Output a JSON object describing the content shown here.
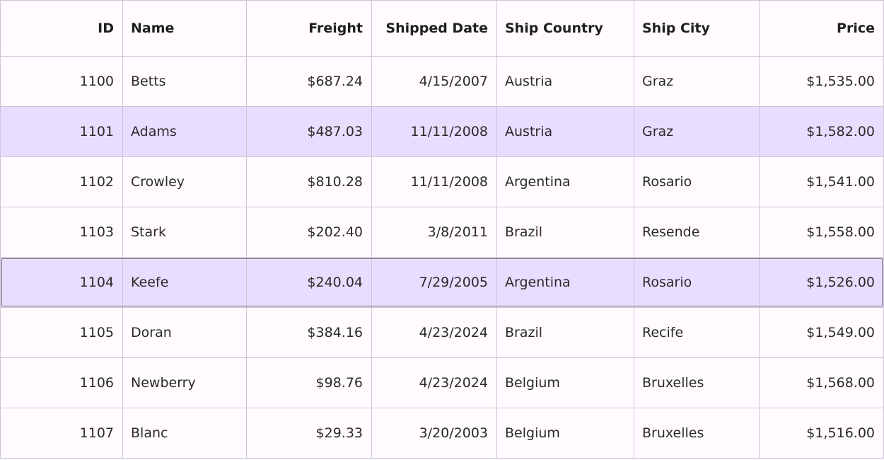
{
  "grid": {
    "columns": [
      {
        "key": "id",
        "label": "ID",
        "align": "right"
      },
      {
        "key": "name",
        "label": "Name",
        "align": "left"
      },
      {
        "key": "freight",
        "label": "Freight",
        "align": "right"
      },
      {
        "key": "shipped_date",
        "label": "Shipped Date",
        "align": "right"
      },
      {
        "key": "ship_country",
        "label": "Ship Country",
        "align": "left"
      },
      {
        "key": "ship_city",
        "label": "Ship City",
        "align": "left"
      },
      {
        "key": "price",
        "label": "Price",
        "align": "right"
      }
    ],
    "rows": [
      {
        "id": "1100",
        "name": "Betts",
        "freight": "$687.24",
        "shipped_date": "4/15/2007",
        "ship_country": "Austria",
        "ship_city": "Graz",
        "price": "$1,535.00",
        "selected": false
      },
      {
        "id": "1101",
        "name": "Adams",
        "freight": "$487.03",
        "shipped_date": "11/11/2008",
        "ship_country": "Austria",
        "ship_city": "Graz",
        "price": "$1,582.00",
        "selected": true
      },
      {
        "id": "1102",
        "name": "Crowley",
        "freight": "$810.28",
        "shipped_date": "11/11/2008",
        "ship_country": "Argentina",
        "ship_city": "Rosario",
        "price": "$1,541.00",
        "selected": false
      },
      {
        "id": "1103",
        "name": "Stark",
        "freight": "$202.40",
        "shipped_date": "3/8/2011",
        "ship_country": "Brazil",
        "ship_city": "Resende",
        "price": "$1,558.00",
        "selected": false
      },
      {
        "id": "1104",
        "name": "Keefe",
        "freight": "$240.04",
        "shipped_date": "7/29/2005",
        "ship_country": "Argentina",
        "ship_city": "Rosario",
        "price": "$1,526.00",
        "selected": true,
        "focused": true
      },
      {
        "id": "1105",
        "name": "Doran",
        "freight": "$384.16",
        "shipped_date": "4/23/2024",
        "ship_country": "Brazil",
        "ship_city": "Recife",
        "price": "$1,549.00",
        "selected": false
      },
      {
        "id": "1106",
        "name": "Newberry",
        "freight": "$98.76",
        "shipped_date": "4/23/2024",
        "ship_country": "Belgium",
        "ship_city": "Bruxelles",
        "price": "$1,568.00",
        "selected": false
      },
      {
        "id": "1107",
        "name": "Blanc",
        "freight": "$29.33",
        "shipped_date": "3/20/2003",
        "ship_country": "Belgium",
        "ship_city": "Bruxelles",
        "price": "$1,516.00",
        "selected": false
      }
    ]
  },
  "colors": {
    "background": "#fffbfe",
    "selected_row": "#e8ddff",
    "grid_line": "#cdc6d6",
    "focus_border": "#79747e"
  }
}
